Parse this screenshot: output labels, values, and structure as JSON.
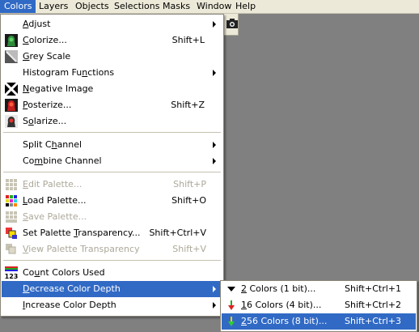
{
  "menubar": {
    "items": [
      "Colors",
      "Layers",
      "Objects",
      "Selections",
      "Masks",
      "Window",
      "Help"
    ]
  },
  "colors_menu": {
    "items": [
      {
        "label": "Adjust",
        "shortcut": "",
        "submenu": true,
        "icon": ""
      },
      {
        "label": "Colorize...",
        "shortcut": "Shift+L",
        "icon": "colorize-icon"
      },
      {
        "label": "Grey Scale",
        "shortcut": "",
        "icon": "grey-scale-icon"
      },
      {
        "label": "Histogram Functions",
        "shortcut": "",
        "submenu": true,
        "icon": ""
      },
      {
        "label": "Negative Image",
        "shortcut": "",
        "icon": "negative-image-icon"
      },
      {
        "label": "Posterize...",
        "shortcut": "Shift+Z",
        "icon": "posterize-icon"
      },
      {
        "label": "Solarize...",
        "shortcut": "",
        "icon": "solarize-icon"
      },
      {
        "label": "Split Channel",
        "shortcut": "",
        "submenu": true,
        "icon": ""
      },
      {
        "label": "Combine Channel",
        "shortcut": "",
        "submenu": true,
        "icon": ""
      },
      {
        "label": "Edit Palette...",
        "shortcut": "Shift+P",
        "disabled": true,
        "icon": "edit-palette-icon"
      },
      {
        "label": "Load Palette...",
        "shortcut": "Shift+O",
        "icon": "load-palette-icon"
      },
      {
        "label": "Save Palette...",
        "shortcut": "",
        "disabled": true,
        "icon": "save-palette-icon"
      },
      {
        "label": "Set Palette Transparency...",
        "shortcut": "Shift+Ctrl+V",
        "icon": "set-transparency-icon"
      },
      {
        "label": "View Palette Transparency",
        "shortcut": "Shift+V",
        "disabled": true,
        "icon": "view-transparency-icon"
      },
      {
        "label": "Count Colors Used",
        "shortcut": "",
        "icon": "count-colors-icon"
      },
      {
        "label": "Decrease Color Depth",
        "shortcut": "",
        "submenu": true,
        "highlighted": true,
        "icon": ""
      },
      {
        "label": "Increase Color Depth",
        "shortcut": "",
        "submenu": true,
        "icon": ""
      }
    ]
  },
  "decrease_submenu": {
    "items": [
      {
        "label": "2 Colors (1 bit)...",
        "shortcut": "Shift+Ctrl+1",
        "icon": "two-colors-icon"
      },
      {
        "label": "16 Colors (4 bit)...",
        "shortcut": "Shift+Ctrl+2",
        "icon": "sixteen-colors-icon"
      },
      {
        "label": "256 Colors (8 bit)...",
        "shortcut": "Shift+Ctrl+3",
        "highlighted": true,
        "icon": "256-colors-icon"
      }
    ]
  },
  "colors": {
    "highlight": "#316ac5",
    "menubar_bg": "#ece9d8",
    "workspace": "#808080",
    "disabled_text": "#aca899"
  }
}
